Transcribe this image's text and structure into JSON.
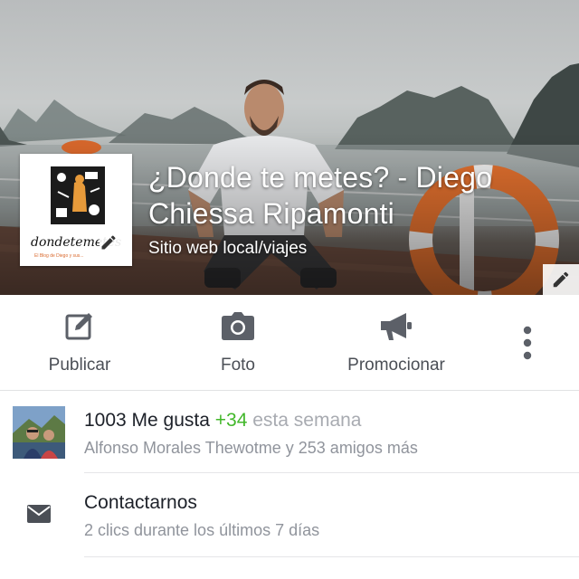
{
  "page": {
    "name": "¿Donde te metes? - Diego Chiessa Ripamonti",
    "category": "Sitio web local/viajes"
  },
  "profile": {
    "logo_text": "dondetemetes",
    "logo_tagline": "El Blog de Diego y sus..."
  },
  "actions": [
    {
      "label": "Publicar",
      "icon": "compose-icon"
    },
    {
      "label": "Foto",
      "icon": "camera-icon"
    },
    {
      "label": "Promocionar",
      "icon": "megaphone-icon"
    },
    {
      "label": "",
      "icon": "more-vertical-icon"
    }
  ],
  "likes": {
    "count_text": "1003 Me gusta",
    "delta": "+34",
    "period": "esta semana",
    "friends": "Alfonso Morales Thewotme y 253 amigos más"
  },
  "contact": {
    "title": "Contactarnos",
    "subtitle": "2 clics durante los últimos 7 días"
  },
  "colors": {
    "accent_green": "#42b72a",
    "icon_gray": "#4b4f56",
    "subtext_gray": "#90949c"
  }
}
